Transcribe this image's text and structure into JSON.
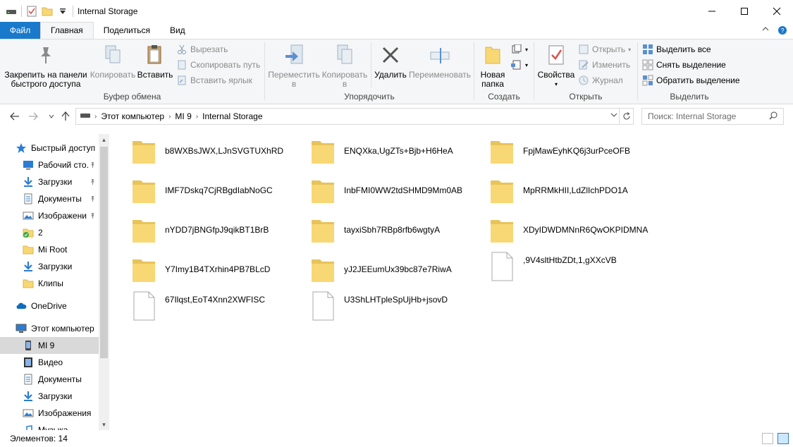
{
  "window": {
    "title": "Internal Storage",
    "controls": [
      "minimize",
      "maximize",
      "close"
    ]
  },
  "tabs": [
    {
      "label": "Файл",
      "active": false,
      "file": true
    },
    {
      "label": "Главная",
      "active": true
    },
    {
      "label": "Поделиться",
      "active": false
    },
    {
      "label": "Вид",
      "active": false
    }
  ],
  "ribbon": {
    "clipboard": {
      "name": "Буфер обмена",
      "pin_label_1": "Закрепить на панели",
      "pin_label_2": "быстрого доступа",
      "copy": "Копировать",
      "paste": "Вставить",
      "cut": "Вырезать",
      "copy_path": "Скопировать путь",
      "paste_shortcut": "Вставить ярлык"
    },
    "organize": {
      "name": "Упорядочить",
      "move_1": "Переместить",
      "move_2": "в",
      "copy_1": "Копировать",
      "copy_2": "в",
      "delete": "Удалить",
      "rename": "Переименовать"
    },
    "create": {
      "name": "Создать",
      "new_folder_1": "Новая",
      "new_folder_2": "папка"
    },
    "open": {
      "name": "Открыть",
      "properties": "Свойства",
      "open": "Открыть",
      "edit": "Изменить",
      "history": "Журнал"
    },
    "select": {
      "name": "Выделить",
      "select_all": "Выделить все",
      "select_none": "Снять выделение",
      "invert": "Обратить выделение"
    }
  },
  "address": {
    "crumbs": [
      "Этот компьютер",
      "MI 9",
      "Internal Storage"
    ],
    "search_placeholder": "Поиск: Internal Storage"
  },
  "navpane": [
    {
      "label": "Быстрый доступ",
      "icon": "star-icon",
      "pinned": false,
      "indent": 0,
      "selected": false
    },
    {
      "label": "Рабочий сто.",
      "icon": "desktop-icon",
      "pinned": true,
      "indent": 1,
      "selected": false
    },
    {
      "label": "Загрузки",
      "icon": "download-icon",
      "pinned": true,
      "indent": 1,
      "selected": false
    },
    {
      "label": "Документы",
      "icon": "documents-icon",
      "pinned": true,
      "indent": 1,
      "selected": false
    },
    {
      "label": "Изображени",
      "icon": "pictures-icon",
      "pinned": true,
      "indent": 1,
      "selected": false
    },
    {
      "label": "2",
      "icon": "folder-sync-icon",
      "pinned": false,
      "indent": 1,
      "selected": false
    },
    {
      "label": "Mi Root",
      "icon": "folder-icon",
      "pinned": false,
      "indent": 1,
      "selected": false
    },
    {
      "label": "Загрузки",
      "icon": "download-icon",
      "pinned": false,
      "indent": 1,
      "selected": false
    },
    {
      "label": "Клипы",
      "icon": "folder-icon",
      "pinned": false,
      "indent": 1,
      "selected": false
    },
    {
      "label": "OneDrive",
      "icon": "onedrive-icon",
      "pinned": false,
      "indent": 0,
      "selected": false,
      "gap": true
    },
    {
      "label": "Этот компьютер",
      "icon": "computer-icon",
      "pinned": false,
      "indent": 0,
      "selected": false,
      "gap": true
    },
    {
      "label": "MI 9",
      "icon": "phone-icon",
      "pinned": false,
      "indent": 1,
      "selected": true
    },
    {
      "label": "Видео",
      "icon": "video-icon",
      "pinned": false,
      "indent": 1,
      "selected": false
    },
    {
      "label": "Документы",
      "icon": "documents-icon",
      "pinned": false,
      "indent": 1,
      "selected": false
    },
    {
      "label": "Загрузки",
      "icon": "download-icon",
      "pinned": false,
      "indent": 1,
      "selected": false
    },
    {
      "label": "Изображения",
      "icon": "pictures-icon",
      "pinned": false,
      "indent": 1,
      "selected": false
    },
    {
      "label": "Музыка",
      "icon": "music-icon",
      "pinned": false,
      "indent": 1,
      "selected": false
    }
  ],
  "files": [
    {
      "name": "b8WXBsJWX,LJnSVGTUXhRD",
      "type": "folder"
    },
    {
      "name": "ENQXka,UgZTs+Bjb+H6HeA",
      "type": "folder"
    },
    {
      "name": "FpjMawEyhKQ6j3urPceOFB",
      "type": "folder"
    },
    {
      "name": "IMF7Dskq7CjRBgdIabNoGC",
      "type": "folder"
    },
    {
      "name": "InbFMI0WW2tdSHMD9Mm0AB",
      "type": "folder"
    },
    {
      "name": "MpRRMkHII,LdZlIchPDO1A",
      "type": "folder"
    },
    {
      "name": "nYDD7jBNGfpJ9qikBT1BrB",
      "type": "folder"
    },
    {
      "name": "tayxiSbh7RBp8rfb6wgtyA",
      "type": "folder"
    },
    {
      "name": "XDyIDWDMNnR6QwOKPIDMNA",
      "type": "folder"
    },
    {
      "name": "Y7Imy1B4TXrhin4PB7BLcD",
      "type": "folder"
    },
    {
      "name": "yJ2JEEumUx39bc87e7RiwA",
      "type": "folder"
    },
    {
      "name": ",9V4sltHtbZDt,1,gXXcVB",
      "type": "file"
    },
    {
      "name": "67Ilqst,EoT4Xnn2XWFISC",
      "type": "file"
    },
    {
      "name": "U3ShLHTpleSpUjHb+jsovD",
      "type": "file"
    }
  ],
  "status": {
    "count_label": "Элементов: 14"
  },
  "colors": {
    "accent": "#1979ca",
    "folder": "#f8d775",
    "selection": "#d9d9d9"
  }
}
